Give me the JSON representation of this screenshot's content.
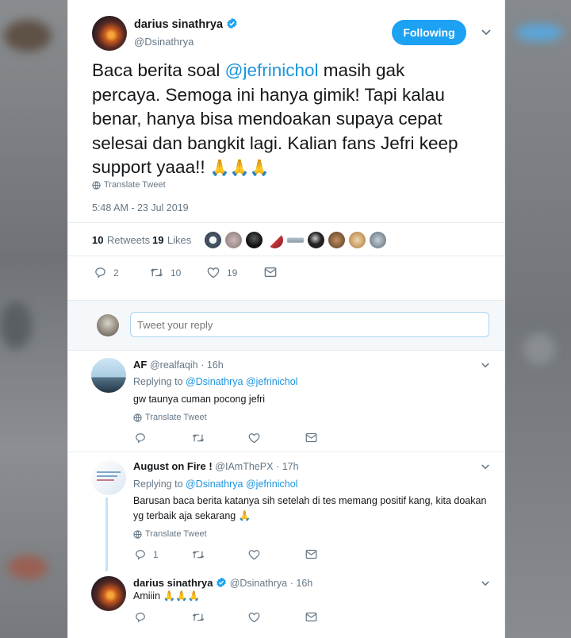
{
  "main_tweet": {
    "author_name": "darius sinathrya",
    "author_handle": "@Dsinathrya",
    "follow_label": "Following",
    "text_lines": {
      "l1a": "Baca berita soal ",
      "l1_mention": "@jefrinichol",
      "l1b": " masih gak",
      "l2": "percaya. Semoga ini hanya gimik!  Tapi kalau",
      "l3": "benar, hanya bisa mendoakan supaya cepat",
      "l4": "selesai dan bangkit lagi. Kalian fans Jefri keep",
      "l5": "support yaaa!! ",
      "l5_emoji": "🙏🙏🙏"
    },
    "translate_label": "Translate Tweet",
    "timestamp": "5:48 AM - 23 Jul 2019",
    "retweets_count": "10",
    "retweets_label": "Retweets",
    "likes_count": "19",
    "likes_label": "Likes",
    "actions": {
      "reply_count": "2",
      "retweet_count": "10",
      "like_count": "19"
    }
  },
  "compose": {
    "placeholder": "Tweet your reply"
  },
  "replies": [
    {
      "name": "AF",
      "handle": "@realfaqih",
      "time": "· 16h",
      "replying_label": "Replying to",
      "replying_to_1": "@Dsinathrya",
      "replying_to_2": "@jefrinichol",
      "text": "gw taunya cuman pocong jefri",
      "translate_label": "Translate Tweet"
    },
    {
      "name": "August on Fire !",
      "handle": "@IAmThePX",
      "time": "· 17h",
      "replying_label": "Replying to",
      "replying_to_1": "@Dsinathrya",
      "replying_to_2": "@jefrinichol",
      "text_line1": "Barusan baca berita katanya sih setelah di tes memang positif kang, kita doakan",
      "text_line2": "yg terbaik aja sekarang ",
      "text_emoji": "🙏",
      "translate_label": "Translate Tweet",
      "reply_count": "1"
    },
    {
      "name": "darius sinathrya",
      "handle": "@Dsinathrya",
      "time": "· 16h",
      "text": "Amiiin ",
      "text_emoji": "🙏🙏🙏"
    }
  ],
  "colors": {
    "accent": "#1da1f2",
    "mention": "#1b95e0",
    "muted": "#657786",
    "text": "#14171a",
    "divider": "#e6ecf0"
  },
  "icons": [
    "verified-badge-icon",
    "chevron-down-icon",
    "translate-globe-icon",
    "reply-icon",
    "retweet-icon",
    "like-heart-icon",
    "direct-message-icon"
  ]
}
